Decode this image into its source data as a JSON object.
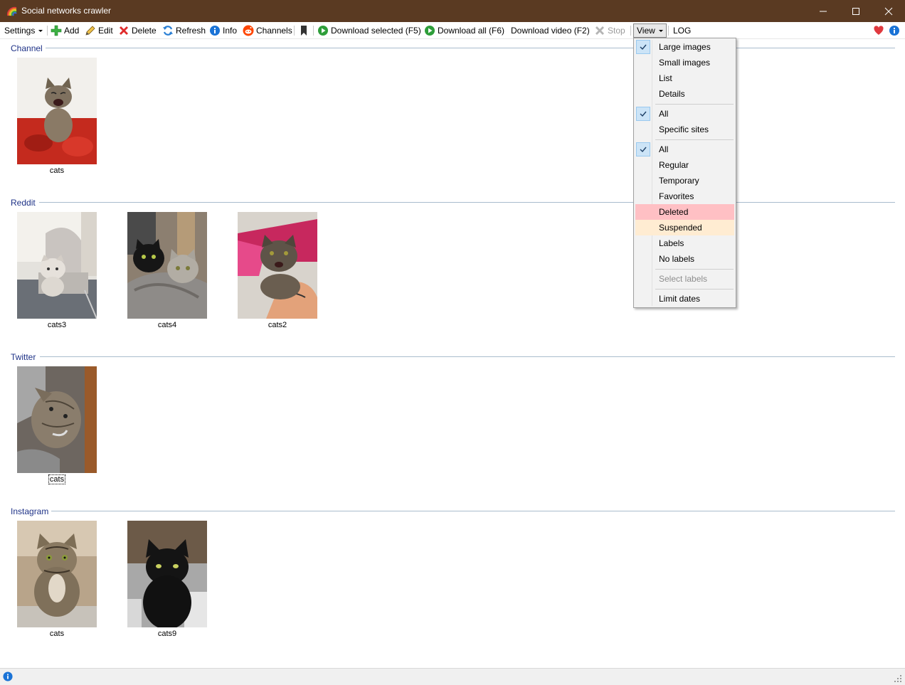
{
  "window": {
    "title": "Social networks crawler"
  },
  "toolbar": {
    "settings": "Settings",
    "add": "Add",
    "edit": "Edit",
    "delete": "Delete",
    "refresh": "Refresh",
    "info": "Info",
    "channels": "Channels",
    "download_selected": "Download selected (F5)",
    "download_all": "Download all (F6)",
    "download_video": "Download video (F2)",
    "stop": "Stop",
    "view": "View",
    "log": "LOG"
  },
  "groups": [
    {
      "name": "Channel",
      "items": [
        {
          "label": "cats",
          "photo_bg": "#c42a1e"
        }
      ]
    },
    {
      "name": "Reddit",
      "items": [
        {
          "label": "cats3",
          "photo_bg": "#c9c4c0"
        },
        {
          "label": "cats4",
          "photo_bg": "#6e6a66"
        },
        {
          "label": "cats2",
          "photo_bg": "#c7285e"
        }
      ]
    },
    {
      "name": "Twitter",
      "items": [
        {
          "label": "cats",
          "photo_bg": "#6d6660"
        }
      ]
    },
    {
      "name": "Instagram",
      "items": [
        {
          "label": "cats",
          "photo_bg": "#b8a48a"
        },
        {
          "label": "cats9",
          "photo_bg": "#a8a8a8"
        }
      ]
    }
  ],
  "view_menu": {
    "items": [
      {
        "label": "Large images",
        "checked": true
      },
      {
        "label": "Small images",
        "checked": false
      },
      {
        "label": "List",
        "checked": false
      },
      {
        "label": "Details",
        "checked": false
      },
      {
        "label": "All",
        "checked": true
      },
      {
        "label": "Specific sites",
        "checked": false
      },
      {
        "label": "All",
        "checked": true
      },
      {
        "label": "Regular",
        "checked": false
      },
      {
        "label": "Temporary",
        "checked": false
      },
      {
        "label": "Favorites",
        "checked": false
      },
      {
        "label": "Deleted",
        "checked": false,
        "highlight": "#ffc0c4"
      },
      {
        "label": "Suspended",
        "checked": false,
        "highlight": "#ffecd2"
      },
      {
        "label": "Labels",
        "checked": false
      },
      {
        "label": "No labels",
        "checked": false
      },
      {
        "label": "Select labels",
        "checked": false,
        "disabled": true
      },
      {
        "label": "Limit dates",
        "checked": false
      }
    ]
  },
  "colors": {
    "titlebar": "#5a3a22",
    "group_header": "#1e3287",
    "info_icon": "#1a73d6",
    "heart_icon": "#e0393e",
    "play_icon": "#2e9e3a"
  }
}
